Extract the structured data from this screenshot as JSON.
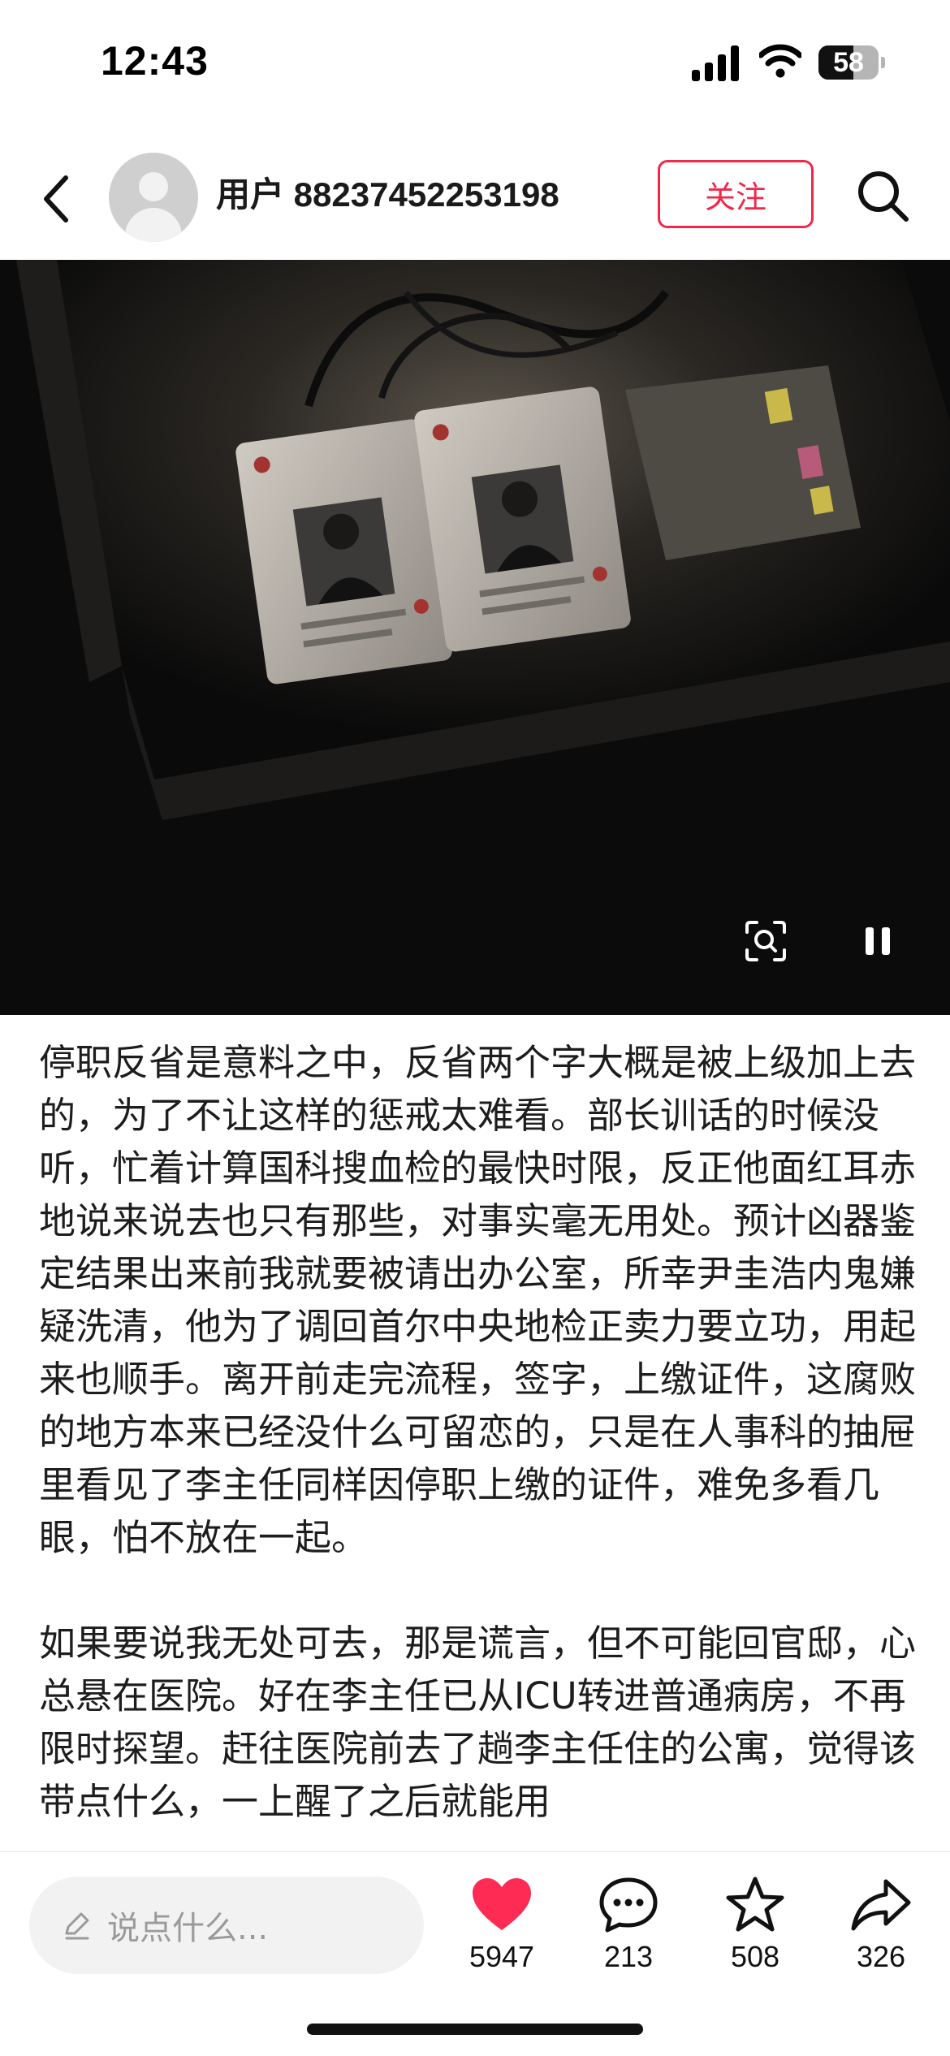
{
  "status_bar": {
    "time": "12:43",
    "battery_level": 58,
    "battery_text": "58",
    "icons": [
      "cellular-signal-icon",
      "wifi-icon",
      "battery-icon"
    ]
  },
  "header": {
    "back_icon": "chevron-left-icon",
    "username": "用户 88237452253198",
    "follow_label": "关注",
    "search_icon": "search-icon",
    "accent_color": "#f0284a"
  },
  "video": {
    "controls": [
      "image-search-icon",
      "pause-icon"
    ]
  },
  "article": {
    "paragraphs": [
      "停职反省是意料之中，反省两个字大概是被上级加上去的，为了不让这样的惩戒太难看。部长训话的时候没听，忙着计算国科搜血检的最快时限，反正他面红耳赤地说来说去也只有那些，对事实毫无用处。预计凶器鉴定结果出来前我就要被请出办公室，所幸尹圭浩内鬼嫌疑洗清，他为了调回首尔中央地检正卖力要立功，用起来也顺手。离开前走完流程，签字，上缴证件，这腐败的地方本来已经没什么可留恋的，只是在人事科的抽屉里看见了李主任同样因停职上缴的证件，难免多看几眼，怕不放在一起。",
      "如果要说我无处可去，那是谎言，但不可能回官邸，心总悬在医院。好在李主任已从ICU转进普通病房，不再限时探望。赶往医院前去了趟李主任住的公寓，觉得该带点什么，一上醒了之后就能用"
    ]
  },
  "bottom_bar": {
    "comment_placeholder": "说点什么...",
    "likes": "5947",
    "comments": "213",
    "favorites": "508",
    "shares": "326",
    "like_color": "#fe2c55"
  }
}
